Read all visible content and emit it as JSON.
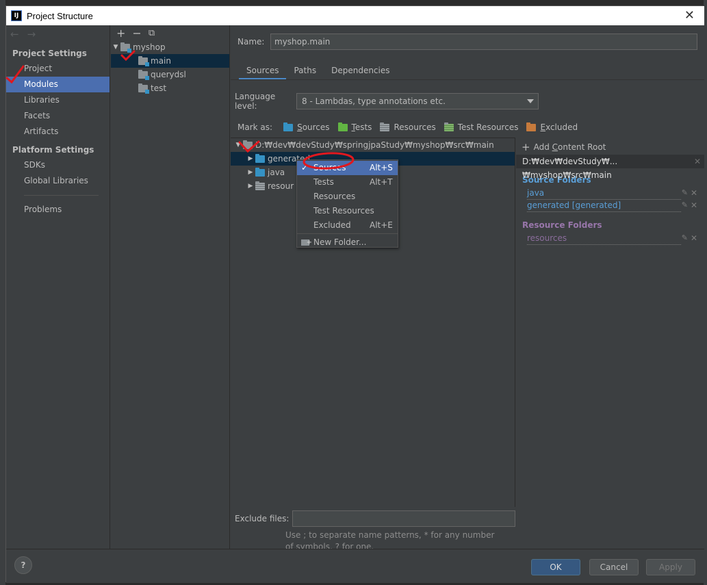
{
  "window": {
    "title": "Project Structure",
    "app_badge": "IJ"
  },
  "nav": {
    "section_project": "Project Settings",
    "project_items": [
      "Project",
      "Modules",
      "Libraries",
      "Facets",
      "Artifacts"
    ],
    "section_platform": "Platform Settings",
    "platform_items": [
      "SDKs",
      "Global Libraries"
    ],
    "problems": "Problems"
  },
  "modules": {
    "toolbar": [
      "+",
      "−",
      "⧉"
    ],
    "root": "myshop",
    "children": [
      "main",
      "querydsl",
      "test"
    ]
  },
  "main": {
    "name_label": "Name:",
    "name_value": "myshop.main",
    "tabs": [
      "Sources",
      "Paths",
      "Dependencies"
    ],
    "language_label": "Language level:",
    "language_value": "8 - Lambdas, type annotations etc.",
    "mark_as_label": "Mark as:",
    "mark_as": {
      "sources": {
        "u": "S",
        "rest": "ources"
      },
      "tests": {
        "u": "T",
        "rest": "ests"
      },
      "resources": "Resources",
      "test_resources": "Test Resources",
      "excluded": {
        "u": "E",
        "rest": "xcluded"
      }
    },
    "tree": {
      "root": "D:₩dev₩devStudy₩springjpaStudy₩myshop₩src₩main",
      "children": [
        "generated",
        "java",
        "resour"
      ]
    },
    "exclude_label": "Exclude files:",
    "exclude_value": "",
    "hint": "Use ; to separate name patterns, * for any number of symbols, ? for one."
  },
  "content_root": {
    "add_label": "Add ",
    "add_underline": "C",
    "add_rest": "ontent Root",
    "path": "D:₩dev₩devStudy₩...₩myshop₩src₩main",
    "source_header": "Source Folders",
    "source_folders": [
      "java",
      "generated [generated]"
    ],
    "resource_header": "Resource Folders",
    "resource_folders": [
      "resources"
    ]
  },
  "context_menu": {
    "items": [
      {
        "label": "Sources",
        "shortcut": "Alt+S"
      },
      {
        "label": "Tests",
        "shortcut": "Alt+T"
      },
      {
        "label": "Resources",
        "shortcut": ""
      },
      {
        "label": "Test Resources",
        "shortcut": ""
      },
      {
        "label": "Excluded",
        "shortcut": "Alt+E"
      }
    ],
    "new_folder": "New Folder..."
  },
  "buttons": {
    "help": "?",
    "ok": "OK",
    "cancel": "Cancel",
    "apply": "Apply"
  },
  "colors": {
    "accent": "#4b6eaf",
    "background": "#3c3f41",
    "annotation": "#e0181e"
  }
}
